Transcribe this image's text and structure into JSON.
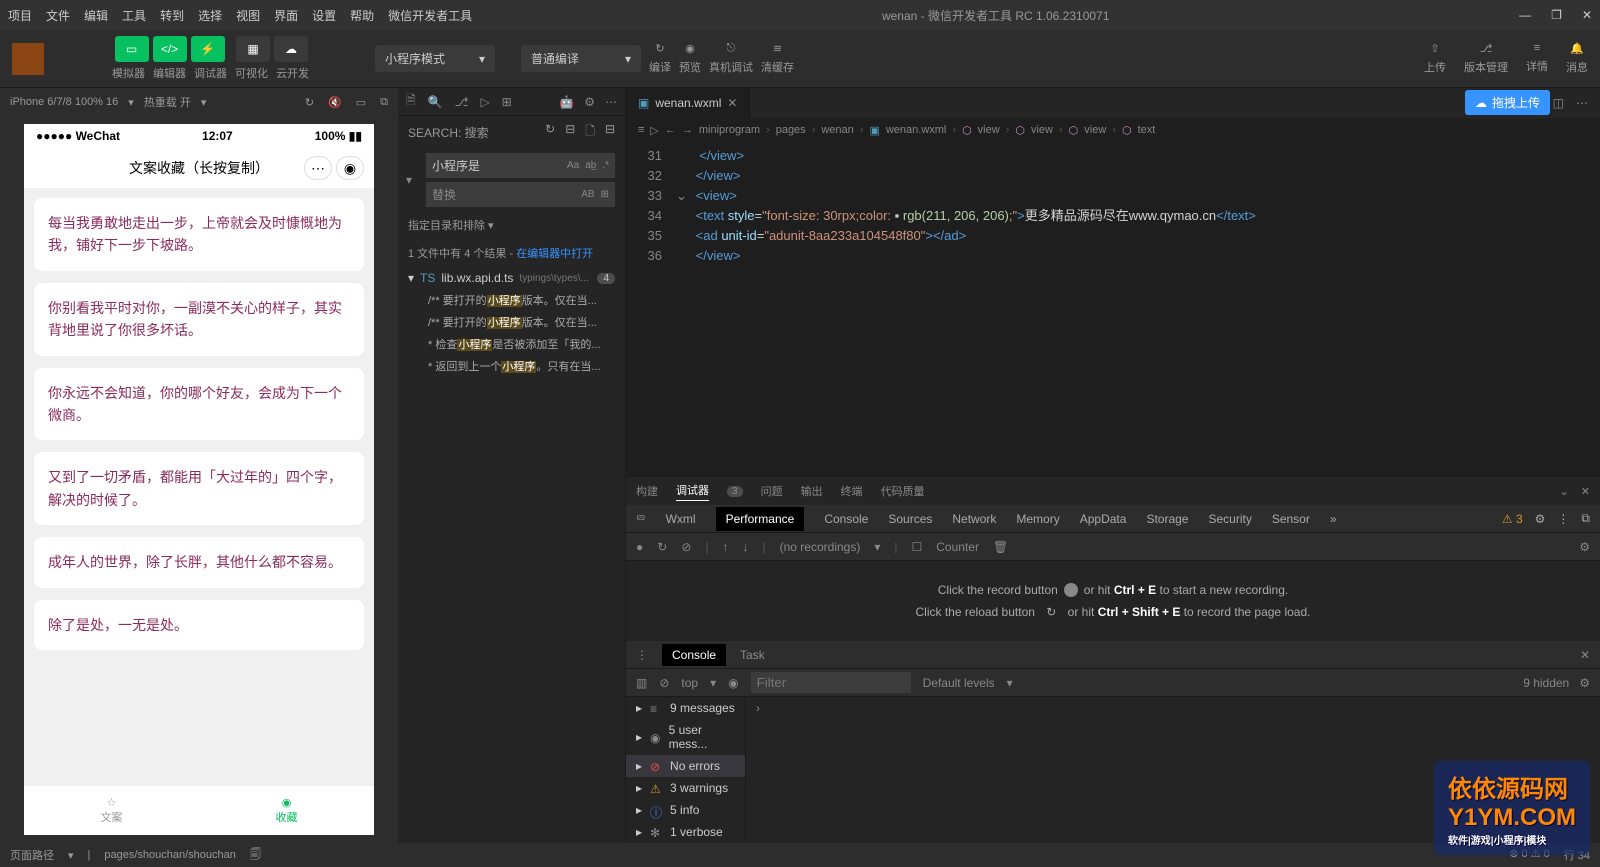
{
  "menubar": {
    "items": [
      "项目",
      "文件",
      "编辑",
      "工具",
      "转到",
      "选择",
      "视图",
      "界面",
      "设置",
      "帮助",
      "微信开发者工具"
    ],
    "title": "wenan - 微信开发者工具 RC 1.06.2310071"
  },
  "toolbar": {
    "mode_labels": [
      "模拟器",
      "编辑器",
      "调试器"
    ],
    "vis_label": "可视化",
    "cloud_label": "云开发",
    "dropdown1": "小程序模式",
    "dropdown2": "普通编译",
    "center_labels": [
      "编译",
      "预览",
      "真机调试",
      "清缓存"
    ],
    "right_labels": [
      "上传",
      "版本管理",
      "详情",
      "消息"
    ]
  },
  "simulator": {
    "device": "iPhone 6/7/8 100% 16",
    "hotreload": "热重载 开",
    "status_carrier": "●●●●● WeChat",
    "status_time": "12:07",
    "status_batt": "100%",
    "nav_title": "文案收藏（长按复制）",
    "cards": [
      "每当我勇敢地走出一步，上帝就会及时慷慨地为我，铺好下一步下坡路。",
      "你别看我平时对你，一副漠不关心的样子，其实背地里说了你很多坏话。",
      "你永远不会知道，你的哪个好友，会成为下一个微商。",
      "又到了一切矛盾，都能用「大过年的」四个字，解决的时候了。",
      "成年人的世界，除了长胖，其他什么都不容易。",
      "除了是处，一无是处。"
    ],
    "tabs": [
      "文案",
      "收藏"
    ]
  },
  "search": {
    "head": "SEARCH: 搜索",
    "query": "小程序是",
    "replace_ph": "替换",
    "section": "指定目录和排除",
    "summary_a": "1 文件中有 4 个结果 - ",
    "summary_b": "在编辑器中打开",
    "file": "lib.wx.api.d.ts",
    "file_path": "typings\\types\\...",
    "count": "4",
    "lines": [
      {
        "pre": "/** 要打开的",
        "hl": "小程序",
        "post": "版本。仅在当..."
      },
      {
        "pre": "/** 要打开的",
        "hl": "小程序",
        "post": "版本。仅在当..."
      },
      {
        "pre": "* 检查",
        "hl": "小程序",
        "post": "是否被添加至「我的..."
      },
      {
        "pre": "* 返回到上一个",
        "hl": "小程序",
        "post": "。只有在当..."
      }
    ]
  },
  "editor": {
    "tab": "wenan.wxml",
    "crumbs": [
      "miniprogram",
      "pages",
      "wenan",
      "wenan.wxml",
      "view",
      "view",
      "view",
      "text"
    ],
    "lines": [
      {
        "n": "31",
        "html": "&nbsp;&nbsp;<span class='t-tag'>&lt;/view&gt;</span>"
      },
      {
        "n": "32",
        "html": "&nbsp;<span class='t-tag'>&lt;/view&gt;</span>"
      },
      {
        "n": "33",
        "html": "&nbsp;<span class='t-tag'>&lt;view&gt;</span>"
      },
      {
        "n": "34",
        "html": "&nbsp;<span class='t-tag'>&lt;text</span> <span class='t-attr'>style</span>=<span class='t-str'>\"font-size: 30rpx;color: </span>▪ <span class='t-rgb'>rgb(211, 206, 206)</span><span class='t-str'>;\"</span><span class='t-tag'>&gt;</span><span class='t-txt'>更多精品源码尽在www.qymao.cn</span><span class='t-tag'>&lt;/text&gt;</span>"
      },
      {
        "n": "35",
        "html": "&nbsp;<span class='t-tag'>&lt;ad</span> <span class='t-attr'>unit-id</span>=<span class='t-str'>\"adunit-8aa233a104548f80\"</span><span class='t-tag'>&gt;&lt;/ad&gt;</span>"
      },
      {
        "n": "36",
        "html": "&nbsp;<span class='t-tag'>&lt;/view&gt;</span>"
      }
    ]
  },
  "panel_tabs": {
    "items": [
      "构建",
      "调试器",
      "问题",
      "输出",
      "终端",
      "代码质量"
    ],
    "badge": "3"
  },
  "devtools": {
    "tabs": [
      "Wxml",
      "Performance",
      "Console",
      "Sources",
      "Network",
      "Memory",
      "AppData",
      "Storage",
      "Security",
      "Sensor"
    ],
    "warn_count": "3",
    "perf_rec": "(no recordings)",
    "perf_counter": "Counter",
    "perf_hint1a": "Click the record button",
    "perf_hint1b": "or hit ",
    "perf_hint1c": "Ctrl + E",
    "perf_hint1d": " to start a new recording.",
    "perf_hint2a": "Click the reload button",
    "perf_hint2b": "or hit ",
    "perf_hint2c": "Ctrl + Shift + E",
    "perf_hint2d": " to record the page load."
  },
  "console": {
    "tabs": [
      "Console",
      "Task"
    ],
    "context": "top",
    "filter_ph": "Filter",
    "levels": "Default levels",
    "hidden": "9 hidden",
    "rows": [
      {
        "ic": "msg",
        "t": "9 messages"
      },
      {
        "ic": "user",
        "t": "5 user mess..."
      },
      {
        "ic": "err",
        "t": "No errors",
        "sel": true
      },
      {
        "ic": "warn",
        "t": "3 warnings"
      },
      {
        "ic": "info",
        "t": "5 info"
      },
      {
        "ic": "verb",
        "t": "1 verbose"
      }
    ],
    "prompt": "›"
  },
  "statusbar": {
    "path_label": "页面路径",
    "path": "pages/shouchan/shouchan",
    "err": "0",
    "warn": "0",
    "pos": "行 34"
  },
  "float": "拖拽上传",
  "wm": {
    "main": "依依源码网",
    "url": "Y1YM.COM",
    "sub": "软件|游戏|小程序|模块"
  }
}
